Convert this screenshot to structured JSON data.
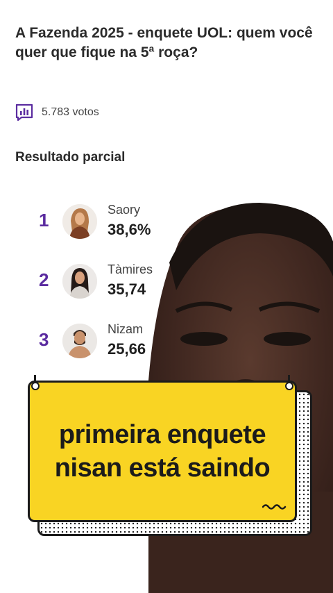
{
  "poll": {
    "title": "A Fazenda 2025 - enquete UOL: quem você quer que fique na 5ª roça?",
    "votes": "5.783 votos",
    "section_title": "Resultado parcial",
    "results": [
      {
        "rank": "1",
        "name": "Saory",
        "percent": "38,6%"
      },
      {
        "rank": "2",
        "name": "Tàmires",
        "percent": "35,74"
      },
      {
        "rank": "3",
        "name": "Nizam",
        "percent": "25,66"
      }
    ]
  },
  "sticker": {
    "text": "primeira enquete nisan está saindo",
    "color": "#f9d423"
  },
  "colors": {
    "accent": "#5b2ca0",
    "text": "#2b2b2b"
  },
  "icons": {
    "votes": "bar-chart-icon",
    "decoration": "squiggle-icon"
  }
}
